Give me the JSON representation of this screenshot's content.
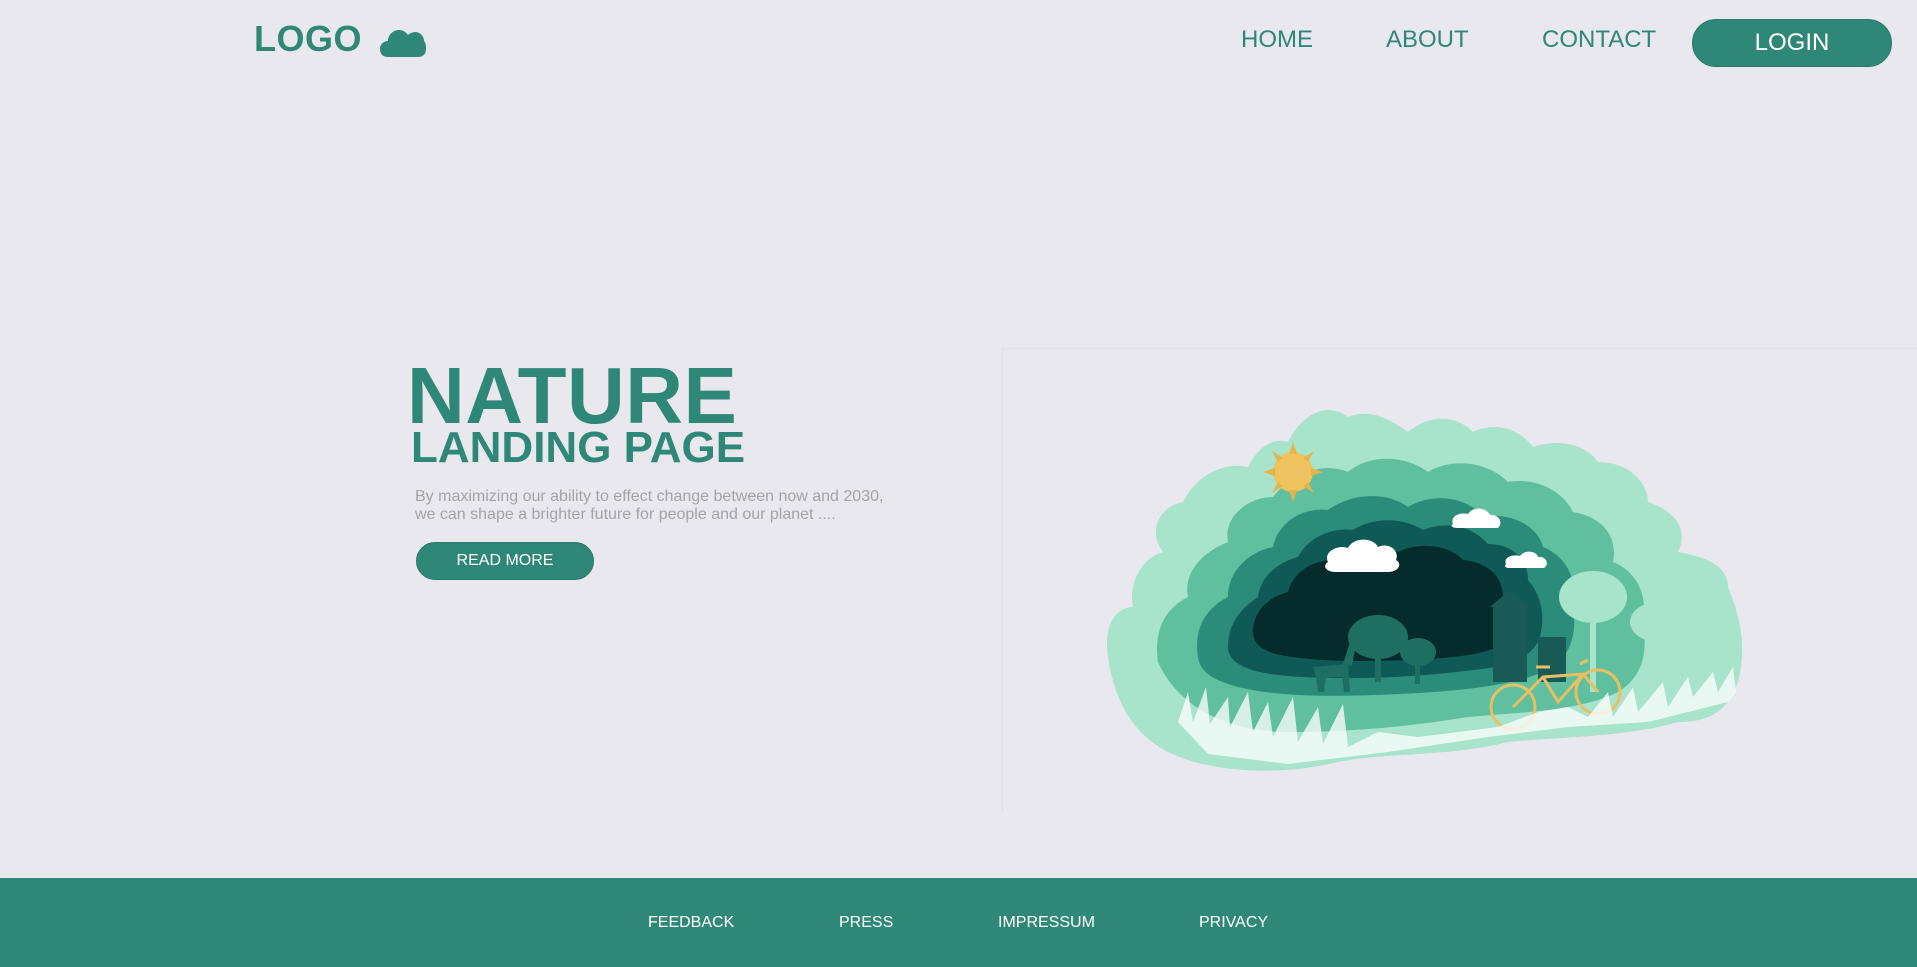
{
  "header": {
    "logo_text": "LOGO",
    "logo_icon": "cloud-icon",
    "nav": {
      "home": "HOME",
      "about": "ABOUT",
      "contact": "CONTACT"
    },
    "login_label": "LOGIN"
  },
  "hero": {
    "title": "NATURE",
    "subtitle": "LANDING PAGE",
    "description_line1": "By maximizing our ability to effect change between now and 2030,",
    "description_line2": "we can shape a brighter future for people and our planet  ....",
    "cta_label": "READ MORE"
  },
  "footer": {
    "links": [
      "FEEDBACK",
      "PRESS",
      "IMPRESSUM",
      "PRIVACY"
    ]
  },
  "colors": {
    "brand": "#2f8777",
    "background": "#e9e8ee",
    "muted_text": "#a3a3a8",
    "footer_bg": "#308878"
  }
}
